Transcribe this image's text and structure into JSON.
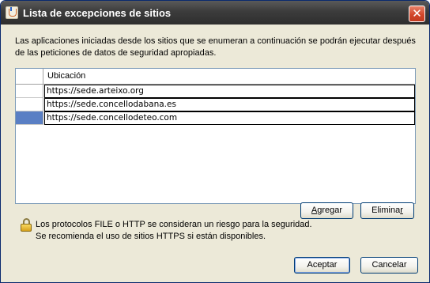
{
  "window": {
    "title": "Lista de excepciones de sitios",
    "close_glyph": "✕"
  },
  "description": "Las aplicaciones iniciadas desde los sitios que se enumeran a continuación se podrán ejecutar después de las peticiones de datos de seguridad apropiadas.",
  "table": {
    "column_header": "Ubicación",
    "rows": [
      {
        "url": "https://sede.arteixo.org",
        "selected": false
      },
      {
        "url": "https://sede.concellodabana.es",
        "selected": false
      },
      {
        "url": "https://sede.concellodeteo.com",
        "selected": true
      }
    ]
  },
  "buttons": {
    "add_prefix": "",
    "add_mnemonic": "A",
    "add_rest": "gregar",
    "remove_prefix": "Elimina",
    "remove_mnemonic": "r",
    "remove_rest": "",
    "accept": "Aceptar",
    "cancel": "Cancelar"
  },
  "security_note": {
    "line1": "Los protocolos FILE o HTTP se consideran un riesgo para la seguridad.",
    "line2": "Se recomienda el uso de sitios HTTPS si están disponibles."
  },
  "icons": {
    "app": "java-cup-icon",
    "close": "close-icon",
    "lock": "lock-icon"
  },
  "colors": {
    "selection": "#5a7fc4",
    "close_button": "#d2462a",
    "titlebar": "#3c3c3c"
  }
}
